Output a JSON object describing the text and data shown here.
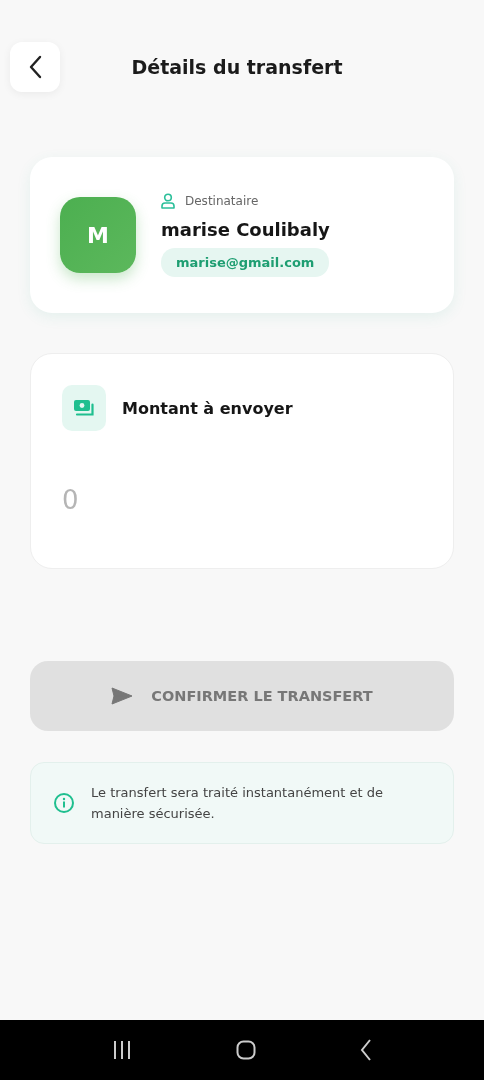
{
  "header": {
    "title": "Détails du transfert"
  },
  "recipient": {
    "initial": "M",
    "label": "Destinataire",
    "name": "marise Coulibaly",
    "email": "marise@gmail.com"
  },
  "amount": {
    "label": "Montant à envoyer",
    "placeholder": "0"
  },
  "confirm_button": {
    "label": "CONFIRMER LE TRANSFERT",
    "disabled": true
  },
  "info": {
    "text": "Le transfert sera traité instantanément et de manière sécurisée."
  }
}
